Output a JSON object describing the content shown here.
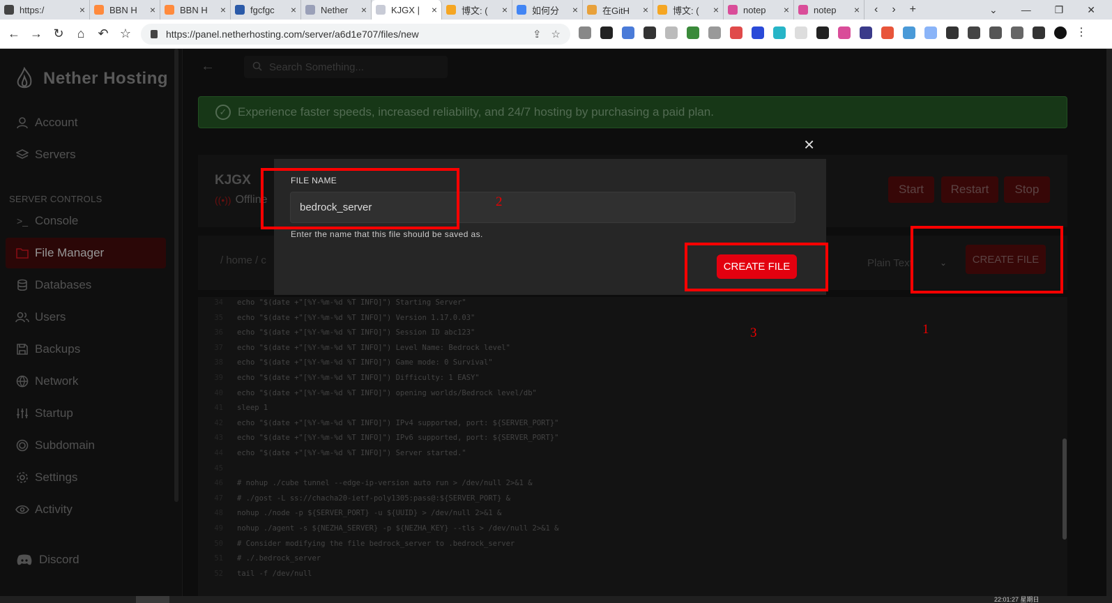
{
  "browser": {
    "tabs": [
      {
        "label": "https:/",
        "fav": "#444"
      },
      {
        "label": "BBN H",
        "fav": "#ff8a3d"
      },
      {
        "label": "BBN H",
        "fav": "#ff8a3d"
      },
      {
        "label": "fgcfgc",
        "fav": "#2b5aa8"
      },
      {
        "label": "Nether",
        "fav": "#9aa0b8"
      },
      {
        "label": "KJGX |",
        "fav": "#c8cbd6"
      },
      {
        "label": "博文: (",
        "fav": "#f5a623"
      },
      {
        "label": "如何分",
        "fav": "#4285f4"
      },
      {
        "label": "在GitH",
        "fav": "#e8a13b"
      },
      {
        "label": "博文: (",
        "fav": "#f5a623"
      },
      {
        "label": "notep",
        "fav": "#d94d99"
      },
      {
        "label": "notep",
        "fav": "#d94d99"
      }
    ],
    "tab_close": "×",
    "new_tab": "+",
    "url": "https://panel.netherhosting.com/server/a6d1e707/files/new"
  },
  "sidebar": {
    "brand": "Nether Hosting",
    "items_top": [
      {
        "label": "Account",
        "icon": "user-icon"
      },
      {
        "label": "Servers",
        "icon": "layers-icon"
      }
    ],
    "section_header": "SERVER CONTROLS",
    "items": [
      {
        "label": "Console",
        "icon": "terminal-icon"
      },
      {
        "label": "File Manager",
        "icon": "folder-icon"
      },
      {
        "label": "Databases",
        "icon": "database-icon"
      },
      {
        "label": "Users",
        "icon": "users-icon"
      },
      {
        "label": "Backups",
        "icon": "save-icon"
      },
      {
        "label": "Network",
        "icon": "globe-icon"
      },
      {
        "label": "Startup",
        "icon": "sliders-icon"
      },
      {
        "label": "Subdomain",
        "icon": "target-icon"
      },
      {
        "label": "Settings",
        "icon": "gear-icon"
      },
      {
        "label": "Activity",
        "icon": "eye-icon"
      }
    ],
    "discord": "Discord"
  },
  "topbar": {
    "search_placeholder": "Search Something..."
  },
  "banner": {
    "text": "Experience faster speeds, increased reliability, and 24/7 hosting by purchasing a paid plan."
  },
  "server": {
    "name": "KJGX",
    "status": "Offline",
    "buttons": {
      "start": "Start",
      "restart": "Restart",
      "stop": "Stop"
    }
  },
  "filebar": {
    "path": "/ home / c",
    "language": "Plain Text",
    "create_label": "CREATE FILE"
  },
  "editor": {
    "lines": [
      {
        "n": "34",
        "t": "echo \"$(date +\"[%Y-%m-%d %T INFO]\") Starting Server\""
      },
      {
        "n": "35",
        "t": "echo \"$(date +\"[%Y-%m-%d %T INFO]\") Version 1.17.0.03\""
      },
      {
        "n": "36",
        "t": "echo \"$(date +\"[%Y-%m-%d %T INFO]\") Session ID abc123\""
      },
      {
        "n": "37",
        "t": "echo \"$(date +\"[%Y-%m-%d %T INFO]\") Level Name: Bedrock level\""
      },
      {
        "n": "38",
        "t": "echo \"$(date +\"[%Y-%m-%d %T INFO]\") Game mode: 0 Survival\""
      },
      {
        "n": "39",
        "t": "echo \"$(date +\"[%Y-%m-%d %T INFO]\") Difficulty: 1 EASY\""
      },
      {
        "n": "40",
        "t": "echo \"$(date +\"[%Y-%m-%d %T INFO]\") opening worlds/Bedrock level/db\""
      },
      {
        "n": "41",
        "t": "sleep 1"
      },
      {
        "n": "42",
        "t": "echo \"$(date +\"[%Y-%m-%d %T INFO]\") IPv4 supported, port: ${SERVER_PORT}\""
      },
      {
        "n": "43",
        "t": "echo \"$(date +\"[%Y-%m-%d %T INFO]\") IPv6 supported, port: ${SERVER_PORT}\""
      },
      {
        "n": "44",
        "t": "echo \"$(date +\"[%Y-%m-%d %T INFO]\") Server started.\""
      },
      {
        "n": "45",
        "t": ""
      },
      {
        "n": "46",
        "t": "# nohup ./cube tunnel --edge-ip-version auto run > /dev/null 2>&1 &"
      },
      {
        "n": "47",
        "t": "# ./gost -L ss://chacha20-ietf-poly1305:pass@:${SERVER_PORT} &"
      },
      {
        "n": "48",
        "t": "nohup ./node -p ${SERVER_PORT} -u ${UUID} > /dev/null 2>&1 &"
      },
      {
        "n": "49",
        "t": "nohup ./agent -s ${NEZHA_SERVER} -p ${NEZHA_KEY} --tls > /dev/null 2>&1 &"
      },
      {
        "n": "50",
        "t": "# Consider modifying the file bedrock_server to .bedrock_server"
      },
      {
        "n": "51",
        "t": "# ./.bedrock_server"
      },
      {
        "n": "52",
        "t": "tail -f /dev/null"
      }
    ]
  },
  "modal": {
    "label": "FILE NAME",
    "value": "bedrock_server",
    "help": "Enter the name that this file should be saved as.",
    "button": "CREATE FILE",
    "close": "×"
  },
  "annotations": {
    "one": "1",
    "two": "2",
    "three": "3",
    "color": "#ff0000"
  },
  "taskbar": {
    "clock": "22:01:27 星期日"
  }
}
